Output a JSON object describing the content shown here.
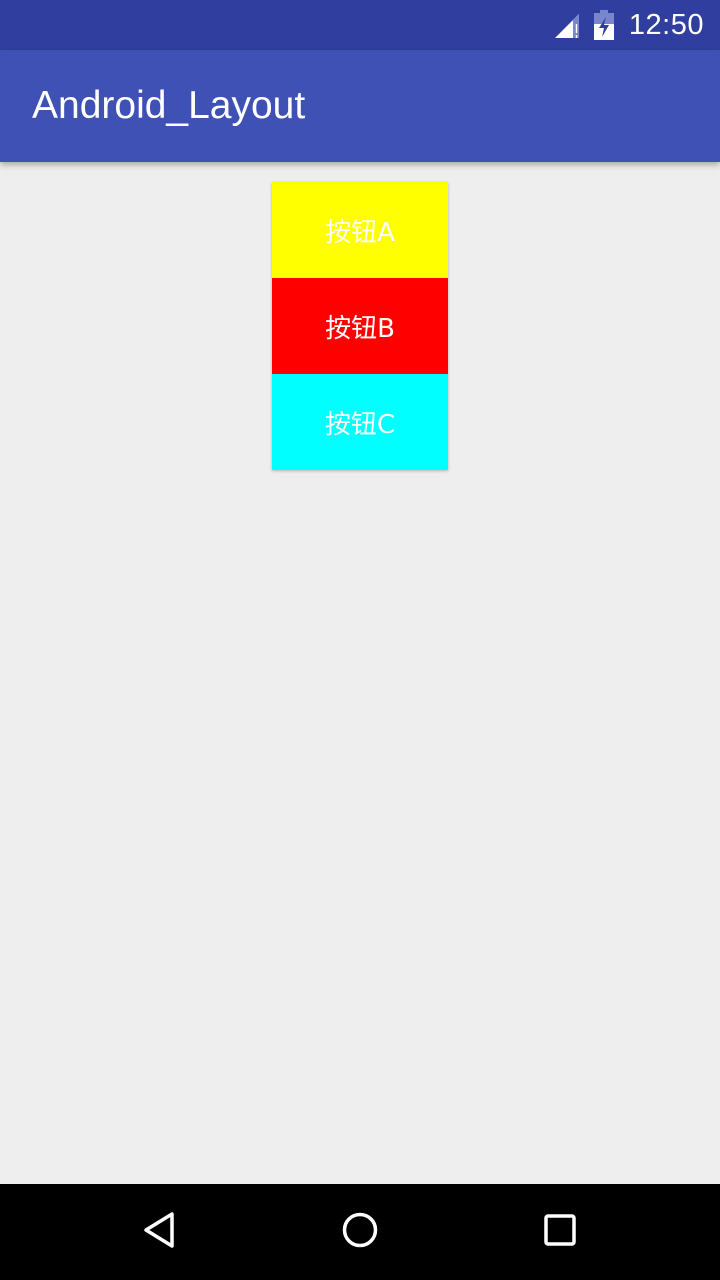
{
  "status_bar": {
    "time": "12:50",
    "icons": [
      "signal-icon",
      "battery-icon"
    ],
    "background": "#303f9f"
  },
  "app_bar": {
    "title": "Android_Layout",
    "background": "#3f51b5"
  },
  "content": {
    "background": "#eeeeee",
    "buttons": [
      {
        "label": "按钮A",
        "color": "#ffff00"
      },
      {
        "label": "按钮B",
        "color": "#ff0000"
      },
      {
        "label": "按钮C",
        "color": "#00ffff"
      }
    ]
  },
  "nav_bar": {
    "icons": [
      "back-icon",
      "home-icon",
      "recents-icon"
    ],
    "background": "#000000"
  }
}
